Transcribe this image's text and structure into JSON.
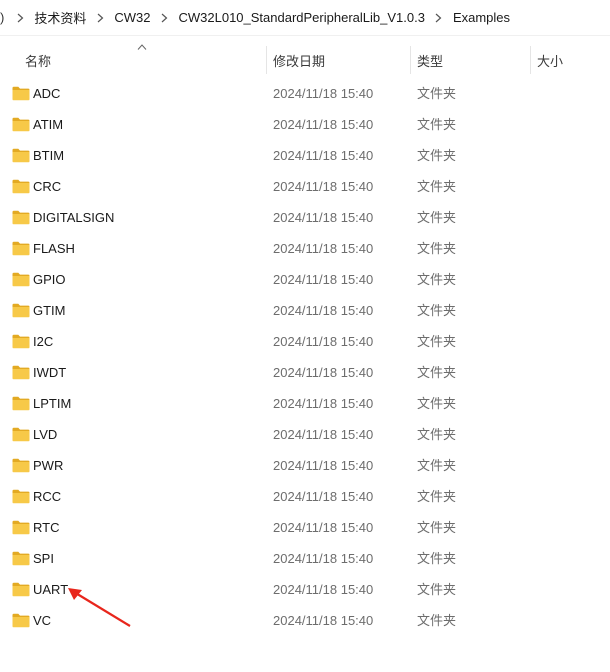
{
  "breadcrumb": {
    "edge_glyph": ")",
    "items": [
      "技术资料",
      "CW32",
      "CW32L010_StandardPeripheralLib_V1.0.3",
      "Examples"
    ]
  },
  "columns": {
    "name": "名称",
    "date": "修改日期",
    "type": "类型",
    "size": "大小"
  },
  "rows": [
    {
      "name": "ADC",
      "date": "2024/11/18 15:40",
      "type": "文件夹",
      "size": ""
    },
    {
      "name": "ATIM",
      "date": "2024/11/18 15:40",
      "type": "文件夹",
      "size": ""
    },
    {
      "name": "BTIM",
      "date": "2024/11/18 15:40",
      "type": "文件夹",
      "size": ""
    },
    {
      "name": "CRC",
      "date": "2024/11/18 15:40",
      "type": "文件夹",
      "size": ""
    },
    {
      "name": "DIGITALSIGN",
      "date": "2024/11/18 15:40",
      "type": "文件夹",
      "size": ""
    },
    {
      "name": "FLASH",
      "date": "2024/11/18 15:40",
      "type": "文件夹",
      "size": ""
    },
    {
      "name": "GPIO",
      "date": "2024/11/18 15:40",
      "type": "文件夹",
      "size": ""
    },
    {
      "name": "GTIM",
      "date": "2024/11/18 15:40",
      "type": "文件夹",
      "size": ""
    },
    {
      "name": "I2C",
      "date": "2024/11/18 15:40",
      "type": "文件夹",
      "size": ""
    },
    {
      "name": "IWDT",
      "date": "2024/11/18 15:40",
      "type": "文件夹",
      "size": ""
    },
    {
      "name": "LPTIM",
      "date": "2024/11/18 15:40",
      "type": "文件夹",
      "size": ""
    },
    {
      "name": "LVD",
      "date": "2024/11/18 15:40",
      "type": "文件夹",
      "size": ""
    },
    {
      "name": "PWR",
      "date": "2024/11/18 15:40",
      "type": "文件夹",
      "size": ""
    },
    {
      "name": "RCC",
      "date": "2024/11/18 15:40",
      "type": "文件夹",
      "size": ""
    },
    {
      "name": "RTC",
      "date": "2024/11/18 15:40",
      "type": "文件夹",
      "size": ""
    },
    {
      "name": "SPI",
      "date": "2024/11/18 15:40",
      "type": "文件夹",
      "size": ""
    },
    {
      "name": "UART",
      "date": "2024/11/18 15:40",
      "type": "文件夹",
      "size": ""
    },
    {
      "name": "VC",
      "date": "2024/11/18 15:40",
      "type": "文件夹",
      "size": ""
    }
  ],
  "annotation": {
    "color": "#e8261c",
    "points_to": "UART"
  },
  "colors": {
    "folder": "#f7c948",
    "folder_dark": "#e3aa23",
    "text_secondary": "#6d6d6d"
  },
  "icons": {
    "folder": "folder-icon",
    "separator": "chevron-right-icon",
    "sort": "sort-ascending-icon"
  }
}
